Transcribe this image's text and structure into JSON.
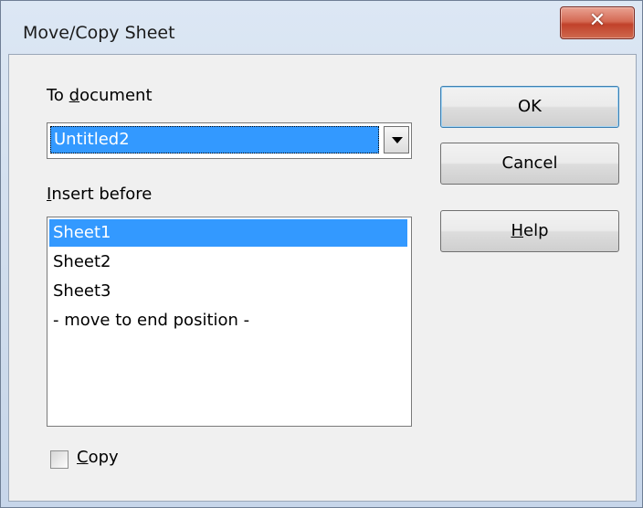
{
  "window": {
    "title": "Move/Copy Sheet",
    "close_icon": "close-icon"
  },
  "to_document": {
    "label_mnemonic_prefix": "To ",
    "label_mnemonic": "d",
    "label_rest": "ocument",
    "selected_value": "Untitled2"
  },
  "insert_before": {
    "label_mnemonic": "I",
    "label_rest": "nsert before",
    "items": [
      {
        "label": "Sheet1",
        "selected": true
      },
      {
        "label": "Sheet2",
        "selected": false
      },
      {
        "label": "Sheet3",
        "selected": false
      },
      {
        "label": "- move to end position -",
        "selected": false
      }
    ]
  },
  "copy": {
    "label_mnemonic": "C",
    "label_rest": "opy",
    "checked": false
  },
  "buttons": {
    "ok": "OK",
    "cancel": "Cancel",
    "help_mnemonic": "H",
    "help_rest": "elp"
  },
  "colors": {
    "selection": "#3399ff",
    "close_button": "#c1412a"
  }
}
